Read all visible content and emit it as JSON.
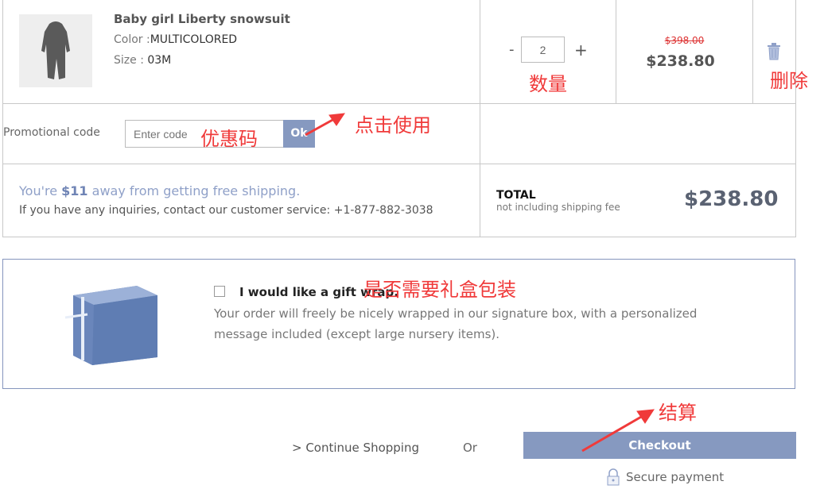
{
  "item": {
    "name": "Baby girl Liberty snowsuit",
    "color_label": "Color :",
    "color_value": "MULTICOLORED",
    "size_label": "Size : ",
    "size_value": "03M",
    "quantity": "2",
    "minus": "-",
    "plus": "+",
    "old_price": "$398.00",
    "price": "$238.80"
  },
  "promo": {
    "label": "Promotional code",
    "placeholder": "Enter code",
    "ok": "Ok"
  },
  "shipping": {
    "prefix": "You're ",
    "amount": "$11",
    "suffix": " away from getting free shipping.",
    "contact": "If you have any inquiries, contact our customer service: +1-877-882-3038"
  },
  "total": {
    "label": "TOTAL",
    "note": "not including shipping fee",
    "value": "$238.80"
  },
  "gift": {
    "label": "I would like a gift wrap.",
    "description_1": "Your order will freely be nicely wrapped in our signature box, with a personalized",
    "description_2": "message included (except large nursery items).",
    "checked": false
  },
  "actions": {
    "continue": "> Continue Shopping",
    "or": "Or",
    "checkout": "Checkout",
    "secure": "Secure payment"
  },
  "annotations": {
    "quantity": "数量",
    "delete": "删除",
    "promo_code": "优惠码",
    "click_use": "点击使用",
    "gift_box": "是否需要礼盒包装",
    "checkout": "结算"
  },
  "colors": {
    "accent": "#8699c0",
    "annotation": "#f03a3a",
    "price_strike": "#d33"
  }
}
